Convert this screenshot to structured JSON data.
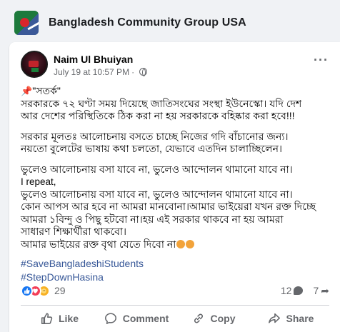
{
  "group": {
    "name": "Bangladesh Community Group USA"
  },
  "post": {
    "author": "Naim Ul Bhuiyan",
    "timestamp": "July 19 at 10:57 PM",
    "separator": "·",
    "pin_icon": "pushpin-icon",
    "title_line": "\"সতর্ক\"",
    "paragraphs": [
      "সরকারকে ৭২ ঘণ্টা সময় দিয়েছে জাতিসংঘের সংস্থা ইউনেস্কো। যদি দেশ\nআর দেশের পরিস্থিতিকে ঠিক করা না হয় সরকারকে বহিষ্কার করা হবে!!!",
      "সরকার মূলতঃ আলোচনায় বসতে চাচ্ছে নিজের গদি বাঁচানোর জন্য।\nনয়তো বুলেটের ভাষায় কথা চলতো, যেভাবে এতদিন চালাচ্ছিলেন।",
      "ভুলেও আলোচনায় বসা যাবে না, ভুলেও আন্দোলন থামানো যাবে না।"
    ],
    "repeat_label": "I repeat,",
    "paragraph_after": "ভুলেও আলোচনায় বসা যাবে না, ভুলেও আন্দোলন থামানো যাবে না।\nকোন আপস আর হবে না আমরা মানবোনা।আমার ভাইয়েরা যখন রক্ত দিচ্ছে\nআমরা ১বিন্দু ও পিছু হটবো না।হয় এই সরকার থাকবে না হয় আমরা\nসাধারণ শিক্ষার্থীরা থাকবো।",
    "last_line": "আমার ভাইয়ের রক্ত বৃথা যেতে দিবো না",
    "hashtags": [
      "#SaveBangladeshiStudents",
      "#StepDownHasina"
    ]
  },
  "stats": {
    "reactions_count": "29",
    "comments_count": "12",
    "shares_count": "7"
  },
  "actions": {
    "like": "Like",
    "comment": "Comment",
    "copy": "Copy",
    "share": "Share"
  },
  "colors": {
    "accent": "#1877f2",
    "hashtag": "#385898",
    "secondary_text": "#65676b"
  }
}
